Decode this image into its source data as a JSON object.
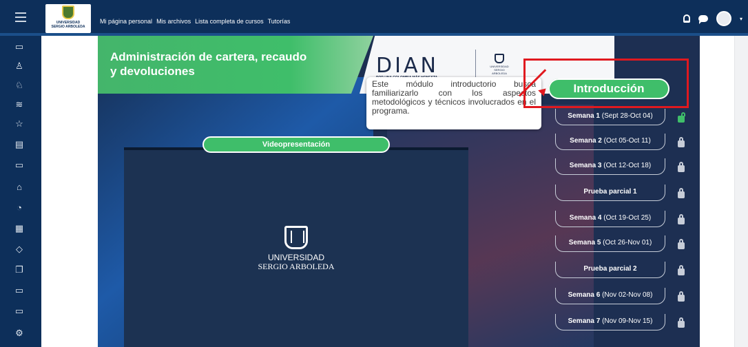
{
  "topbar": {
    "logo_text_line1": "UNIVERSIDAD",
    "logo_text_line2": "SERGIO ARBOLEDA",
    "nav": [
      "Mi página personal",
      "Mis archivos",
      "Lista completa de cursos",
      "Tutorías"
    ]
  },
  "sidebar": {
    "icons": [
      "folder-icon",
      "user-group-icon",
      "user-group-icon",
      "layers-icon",
      "star-icon",
      "book-icon",
      "folder-icon",
      "home-icon",
      "dashboard-icon",
      "calendar-icon",
      "graduation-cap-icon",
      "files-icon",
      "folder-icon",
      "folder-icon",
      "settings-icon"
    ]
  },
  "course": {
    "title": "Administración de cartera, recaudo y devoluciones",
    "dian_logo": "DIAN",
    "dian_tagline": "POR UNA COLOMBIA MÁS HONESTA",
    "partner_logo_text": "UNIVERSIDAD SERGIO ARBOLEDA",
    "video_label": "Videopresentación",
    "video_logo_line1": "UNIVERSIDAD",
    "video_logo_line2": "SERGIO ARBOLEDA",
    "tooltip": "Este módulo introductorio busca familiarizarlo con los aspectos metodológicos y técnicos involucrados en el programa.",
    "intro_label": "Introducción",
    "weeks": [
      {
        "label": "Semana 1",
        "dates": "(Sept 28-Oct 04)",
        "locked": false
      },
      {
        "label": "Semana 2",
        "dates": "(Oct 05-Oct 11)",
        "locked": true
      },
      {
        "label": "Semana 3",
        "dates": "(Oct 12-Oct 18)",
        "locked": true
      },
      {
        "label": "Prueba parcial 1",
        "dates": "",
        "locked": true
      },
      {
        "label": "Semana 4",
        "dates": "(Oct 19-Oct 25)",
        "locked": true
      },
      {
        "label": "Semana 5",
        "dates": "(Oct 26-Nov 01)",
        "locked": true
      },
      {
        "label": "Prueba parcial 2",
        "dates": "",
        "locked": true
      },
      {
        "label": "Semana 6",
        "dates": "(Nov 02-Nov 08)",
        "locked": true
      },
      {
        "label": "Semana 7",
        "dates": "(Nov 09-Nov 15)",
        "locked": true
      }
    ]
  },
  "colors": {
    "navy": "#0d2f5a",
    "green": "#3fbe6a",
    "highlight_red": "#e0191f"
  }
}
